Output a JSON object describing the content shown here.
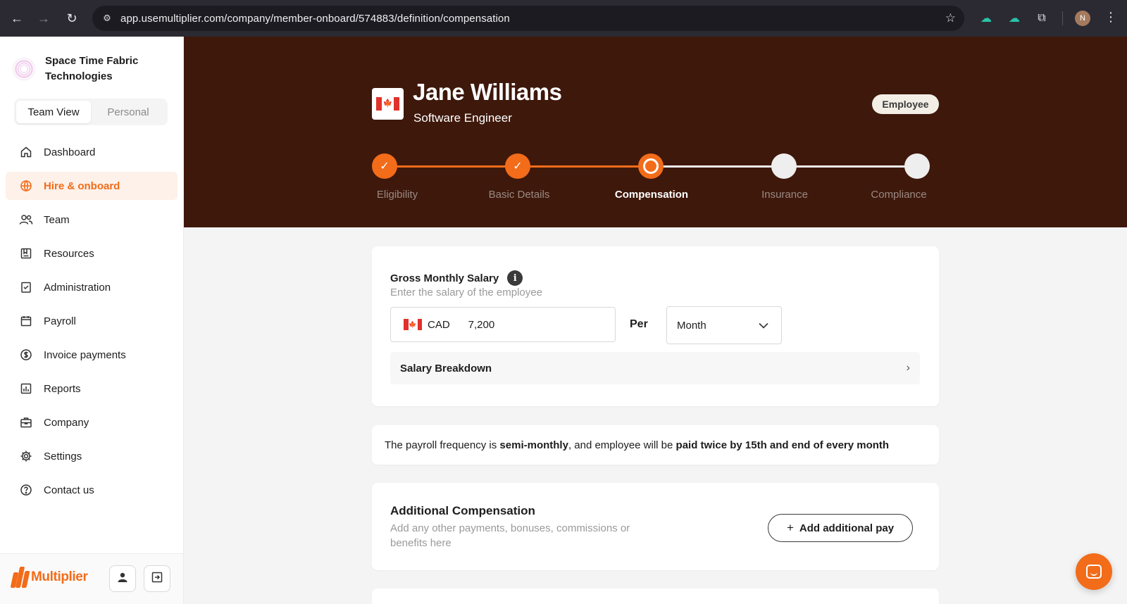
{
  "browser": {
    "url": "app.usemultiplier.com/company/member-onboard/574883/definition/compensation",
    "profile_initial": "N"
  },
  "sidebar": {
    "org_name": "Space Time Fabric Technologies",
    "view_toggle": {
      "team": "Team View",
      "personal": "Personal",
      "active": "team"
    },
    "items": [
      {
        "label": "Dashboard",
        "icon": "home-icon"
      },
      {
        "label": "Hire & onboard",
        "icon": "globe-icon",
        "active": true
      },
      {
        "label": "Team",
        "icon": "team-icon"
      },
      {
        "label": "Resources",
        "icon": "resources-icon"
      },
      {
        "label": "Administration",
        "icon": "clipboard-check-icon"
      },
      {
        "label": "Payroll",
        "icon": "calendar-icon"
      },
      {
        "label": "Invoice payments",
        "icon": "dollar-circle-icon"
      },
      {
        "label": "Reports",
        "icon": "bar-chart-icon"
      },
      {
        "label": "Company",
        "icon": "briefcase-icon"
      },
      {
        "label": "Settings",
        "icon": "gear-icon"
      },
      {
        "label": "Contact us",
        "icon": "help-circle-icon"
      }
    ],
    "brand_name": "Multiplier"
  },
  "header": {
    "employee_name": "Jane Williams",
    "employee_role": "Software Engineer",
    "badge": "Employee",
    "country_flag": "canada-flag"
  },
  "stepper": {
    "steps": [
      {
        "label": "Eligibility",
        "state": "done"
      },
      {
        "label": "Basic Details",
        "state": "done"
      },
      {
        "label": "Compensation",
        "state": "current"
      },
      {
        "label": "Insurance",
        "state": "todo"
      },
      {
        "label": "Compliance",
        "state": "todo"
      }
    ]
  },
  "salary": {
    "title": "Gross Monthly Salary",
    "subtitle": "Enter the salary of the employee",
    "currency": "CAD",
    "amount": "7,200",
    "per_label": "Per",
    "frequency": "Month",
    "breakdown_label": "Salary Breakdown"
  },
  "payroll_note": {
    "prefix": "The payroll frequency is ",
    "frequency": "semi-monthly",
    "middle": ", and employee will be ",
    "schedule": "paid twice by 15th and end of every month"
  },
  "additional": {
    "title": "Additional Compensation",
    "subtitle": "Add any other payments, bonuses, commissions or benefits here",
    "button_label": "Add additional pay"
  },
  "colors": {
    "accent": "#f26c1a",
    "hero_bg": "#3e180b",
    "sidebar_active_bg": "#fdf1e9"
  }
}
